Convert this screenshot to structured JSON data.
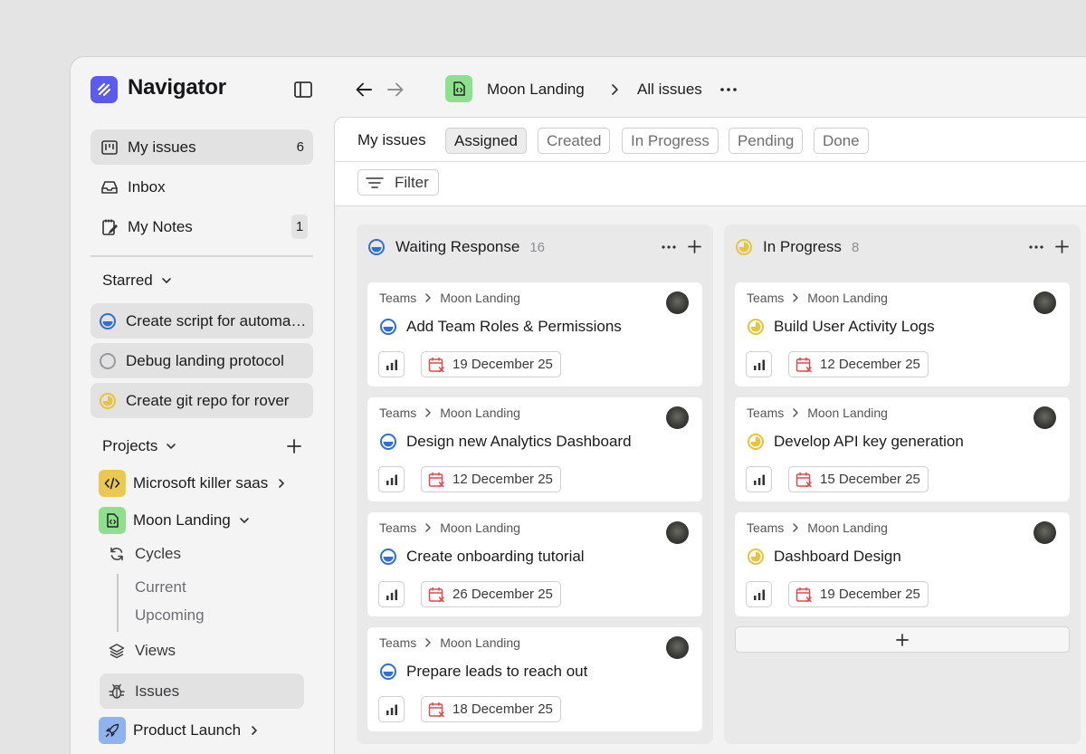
{
  "app": {
    "name": "Navigator"
  },
  "sidebar": {
    "items": [
      {
        "label": "My issues",
        "count": "6",
        "icon": "kanban-icon"
      },
      {
        "label": "Inbox",
        "count": "",
        "icon": "inbox-icon"
      },
      {
        "label": "My Notes",
        "count": "1",
        "icon": "notes-icon"
      }
    ],
    "starred": {
      "heading": "Starred",
      "items": [
        {
          "label": "Create script for automation",
          "status": "in-review"
        },
        {
          "label": "Debug landing protocol",
          "status": "todo"
        },
        {
          "label": "Create git repo for rover",
          "status": "in-progress"
        }
      ]
    },
    "projects": {
      "heading": "Projects",
      "items": [
        {
          "label": "Microsoft killer saas",
          "icon": "code-icon",
          "color": "#e9c94f"
        },
        {
          "label": "Moon Landing",
          "icon": "code-file-icon",
          "color": "#8ee18c"
        },
        {
          "label": "Product Launch",
          "icon": "rocket-icon",
          "color": "#8fb3f0"
        }
      ],
      "moon_landing_children": {
        "cycles": "Cycles",
        "current": "Current",
        "upcoming": "Upcoming",
        "views": "Views",
        "issues": "Issues"
      }
    }
  },
  "topbar": {
    "project": "Moon Landing",
    "current": "All issues"
  },
  "tabs": {
    "title": "My issues",
    "items": [
      "Assigned",
      "Created",
      "In Progress",
      "Pending",
      "Done"
    ],
    "active": "Assigned"
  },
  "filter": {
    "label": "Filter"
  },
  "columns": [
    {
      "name": "Waiting Response",
      "count": "16",
      "status_color": "#2f6fd8",
      "cards": [
        {
          "team": "Teams",
          "project": "Moon Landing",
          "title": "Add Team Roles & Permissions",
          "due": "19 December 25"
        },
        {
          "team": "Teams",
          "project": "Moon Landing",
          "title": "Design new Analytics Dashboard",
          "due": "12 December 25"
        },
        {
          "team": "Teams",
          "project": "Moon Landing",
          "title": "Create onboarding tutorial",
          "due": "26 December 25"
        },
        {
          "team": "Teams",
          "project": "Moon Landing",
          "title": "Prepare leads to reach out",
          "due": "18 December 25"
        }
      ]
    },
    {
      "name": "In Progress",
      "count": "8",
      "status_color": "#e6c53a",
      "cards": [
        {
          "team": "Teams",
          "project": "Moon Landing",
          "title": "Build User Activity Logs",
          "due": "12 December 25"
        },
        {
          "team": "Teams",
          "project": "Moon Landing",
          "title": "Develop API key generation",
          "due": "15 December 25"
        },
        {
          "team": "Teams",
          "project": "Moon Landing",
          "title": "Dashboard Design",
          "due": "19 December 25"
        }
      ]
    }
  ],
  "colors": {
    "accent": "#5b5bf0",
    "overdue": "#e5484d"
  }
}
